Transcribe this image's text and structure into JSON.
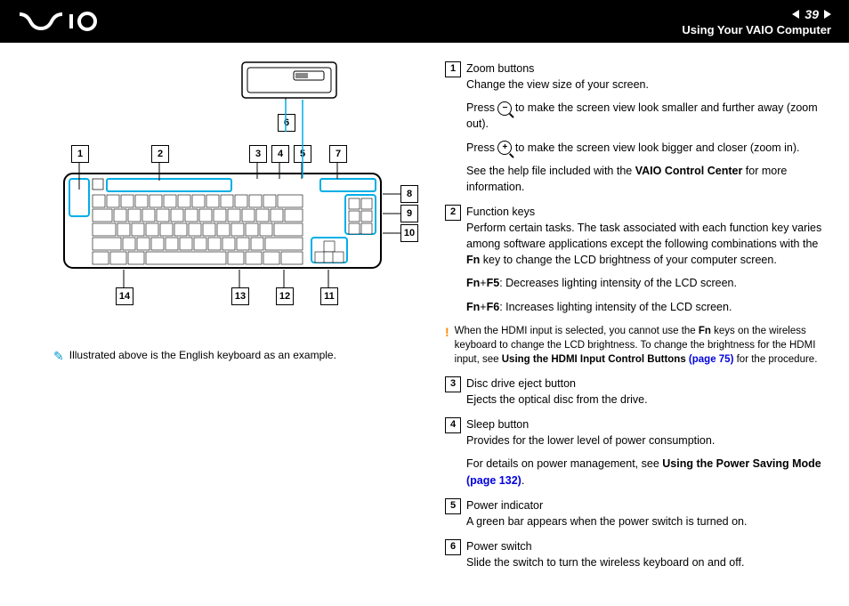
{
  "header": {
    "page_number": "39",
    "title": "Using Your VAIO Computer"
  },
  "caption": "Illustrated above is the English keyboard as an example.",
  "callouts": [
    "1",
    "2",
    "3",
    "4",
    "5",
    "6",
    "7",
    "8",
    "9",
    "10",
    "11",
    "12",
    "13",
    "14"
  ],
  "items": [
    {
      "num": "1",
      "title": "Zoom buttons",
      "paras": [
        "Change the view size of your screen.",
        "Press {ZOOMOUT} to make the screen view look smaller and further away (zoom out).",
        "Press {ZOOMIN} to make the screen view look bigger and closer (zoom in).",
        "See the help file included with the {B}VAIO Control Center{/B} for more information."
      ]
    },
    {
      "num": "2",
      "title": "Function keys",
      "paras": [
        "Perform certain tasks. The task associated with each function key varies among software applications except the following combinations with the {B}Fn{/B} key to change the LCD brightness of your computer screen.",
        "{B}Fn{/B}+{B}F5{/B}: Decreases lighting intensity of the LCD screen.",
        "{B}Fn{/B}+{B}F6{/B}: Increases lighting intensity of the LCD screen."
      ]
    }
  ],
  "warning": {
    "text_parts": [
      "When the HDMI input is selected, you cannot use the ",
      "{B}Fn{/B}",
      " keys on the wireless keyboard to change the LCD brightness. To change the brightness for the HDMI input, see ",
      "{B}Using the HDMI Input Control Buttons {L}(page 75){/L}{/B}",
      " for the procedure."
    ]
  },
  "items2": [
    {
      "num": "3",
      "title": "Disc drive eject button",
      "paras": [
        "Ejects the optical disc from the drive."
      ]
    },
    {
      "num": "4",
      "title": "Sleep button",
      "paras": [
        "Provides for the lower level of power consumption.",
        "For details on power management, see {B}Using the Power Saving Mode {L}(page 132){/L}{/B}."
      ]
    },
    {
      "num": "5",
      "title": "Power indicator",
      "paras": [
        "A green bar appears when the power switch is turned on."
      ]
    },
    {
      "num": "6",
      "title": "Power switch",
      "paras": [
        "Slide the switch to turn the wireless keyboard on and off."
      ]
    }
  ]
}
